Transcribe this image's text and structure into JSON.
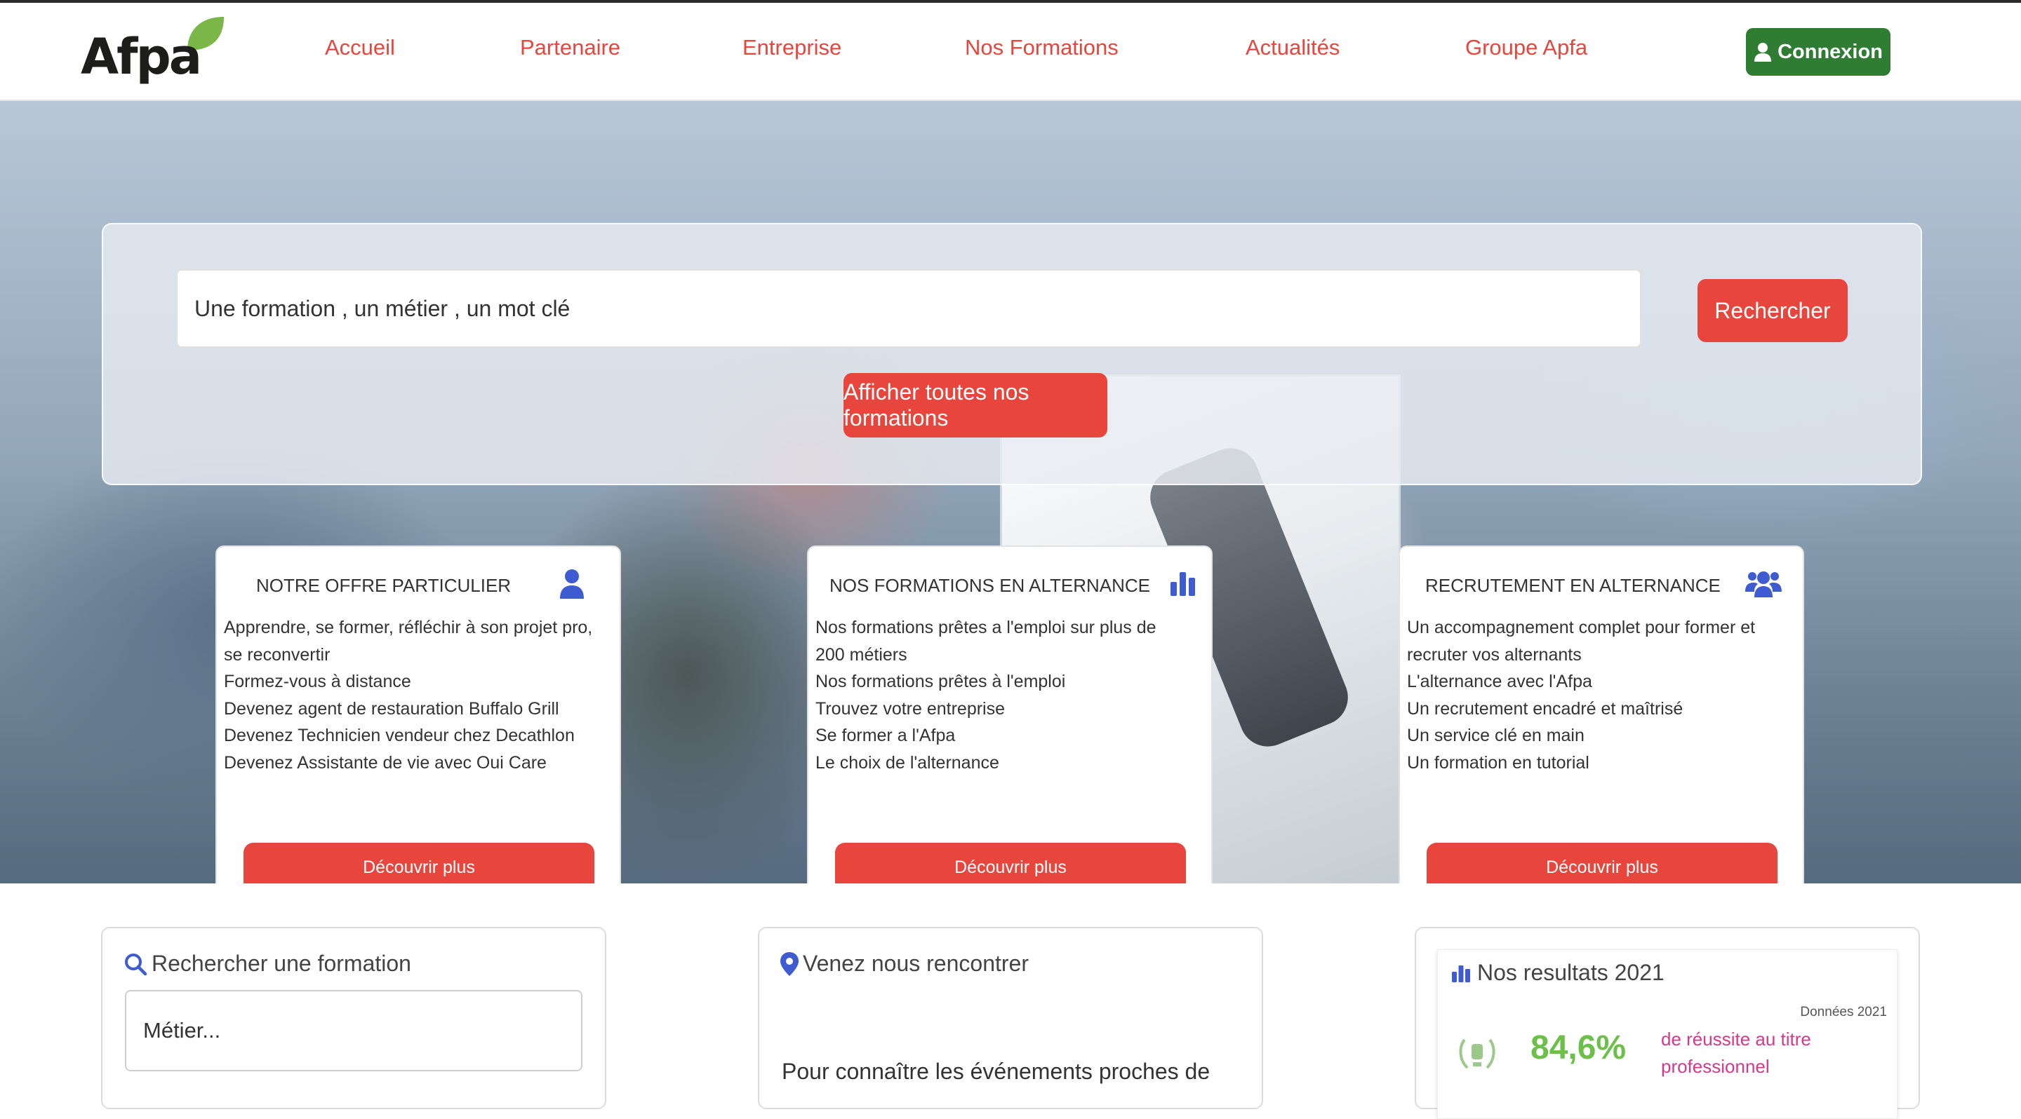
{
  "nav": {
    "logo_text": "Afpa",
    "links": [
      "Accueil",
      "Partenaire",
      "Entreprise",
      "Nos Formations",
      "Actualités",
      "Groupe Apfa"
    ],
    "login_label": "Connexion"
  },
  "hero": {
    "search_placeholder": "Une formation , un métier , un mot clé",
    "search_button": "Rechercher",
    "all_formations_button": "Afficher toutes nos formations"
  },
  "cards": [
    {
      "title": "NOTRE OFFRE PARTICULIER",
      "icon": "user-icon",
      "items": [
        "Apprendre, se former, réfléchir à son projet pro,",
        "se reconvertir",
        "Formez-vous à distance",
        "Devenez agent de restauration Buffalo Grill",
        "Devenez Technicien vendeur chez Decathlon",
        "Devenez Assistante de vie avec Oui Care"
      ],
      "button": "Découvrir plus"
    },
    {
      "title": "NOS FORMATIONS EN ALTERNANCE",
      "icon": "chart-bar-icon",
      "items": [
        "Nos formations prêtes a l'emploi sur plus de",
        "200 métiers",
        "Nos formations prêtes à l'emploi",
        "Trouvez votre entreprise",
        "Se former a l'Afpa",
        "Le choix de l'alternance"
      ],
      "button": "Découvrir plus"
    },
    {
      "title": "RECRUTEMENT EN ALTERNANCE",
      "icon": "users-icon",
      "items": [
        "Un accompagnement complet pour former et",
        "recruter vos alternants",
        "L'alternance avec l'Afpa",
        "Un recrutement encadré et maîtrisé",
        "Un service clé en main",
        "Un formation en tutorial"
      ],
      "button": "Découvrir plus"
    }
  ],
  "bottom": {
    "search_title": "Rechercher une formation",
    "search_placeholder": "Métier...",
    "meet_title": "Venez nous rencontrer",
    "meet_text": "Pour connaître les événements proches de",
    "results_title": "Nos resultats 2021",
    "results_note": "Données 2021",
    "results_value": "84,6%",
    "results_label": "de réussite au titre professionnel"
  },
  "colors": {
    "accent_red": "#e8453c",
    "login_green": "#2e7d32",
    "icon_blue": "#3f5bd1",
    "leaf_green": "#7ab648",
    "result_green": "#6cc04a",
    "result_pink": "#d6388b"
  }
}
